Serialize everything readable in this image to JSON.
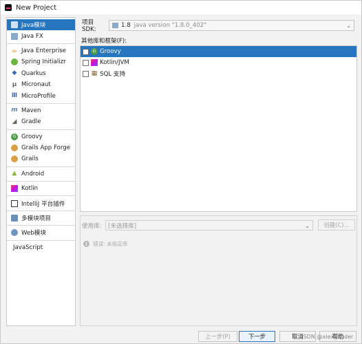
{
  "window": {
    "title": "New Project"
  },
  "sidebar": {
    "groups": [
      [
        {
          "label": "Java模块",
          "icon": "folder-icon",
          "selected": true
        },
        {
          "label": "Java FX",
          "icon": "folder-icon"
        }
      ],
      [
        {
          "label": "Java Enterprise",
          "icon": "coffee-icon"
        },
        {
          "label": "Spring Initializr",
          "icon": "spring-leaf-icon"
        },
        {
          "label": "Quarkus",
          "icon": "quarkus-icon"
        },
        {
          "label": "Micronaut",
          "icon": "micronaut-icon"
        },
        {
          "label": "MicroProfile",
          "icon": "microprofile-icon"
        }
      ],
      [
        {
          "label": "Maven",
          "icon": "maven-icon"
        },
        {
          "label": "Gradle",
          "icon": "gradle-icon"
        }
      ],
      [
        {
          "label": "Groovy",
          "icon": "groovy-icon"
        },
        {
          "label": "Grails App Forge",
          "icon": "grails-icon"
        },
        {
          "label": "Grails",
          "icon": "grails-icon"
        }
      ],
      [
        {
          "label": "Android",
          "icon": "android-icon"
        }
      ],
      [
        {
          "label": "Kotlin",
          "icon": "kotlin-icon"
        }
      ],
      [
        {
          "label": "IntelliJ 平台插件",
          "icon": "intellij-icon"
        }
      ],
      [
        {
          "label": "多模块项目",
          "icon": "multi-module-icon"
        }
      ],
      [
        {
          "label": "Web模块",
          "icon": "web-icon"
        }
      ],
      [
        {
          "label": "JavaScript",
          "icon": ""
        }
      ]
    ]
  },
  "sdk": {
    "label": "项目 SDK:",
    "version": "1.8",
    "detail": "java version \"1.8.0_402\""
  },
  "libraries": {
    "label": "其他库和框架(F):",
    "items": [
      {
        "label": "Groovy",
        "icon": "groovy-icon",
        "selected": true
      },
      {
        "label": "Kotlin/JVM",
        "icon": "kotlin-icon"
      },
      {
        "label": "SQL 支持",
        "icon": "sql-icon"
      }
    ]
  },
  "detail": {
    "use_lib_label": "使用库:",
    "use_lib_value": "[未选择库]",
    "create_label": "创建(C)...",
    "error_text": "错误: 未指定库"
  },
  "footer": {
    "prev": "上一步(P)",
    "next": "下一步",
    "cancel": "取消",
    "help": "帮助"
  },
  "watermark": "CSDN @alexSander"
}
